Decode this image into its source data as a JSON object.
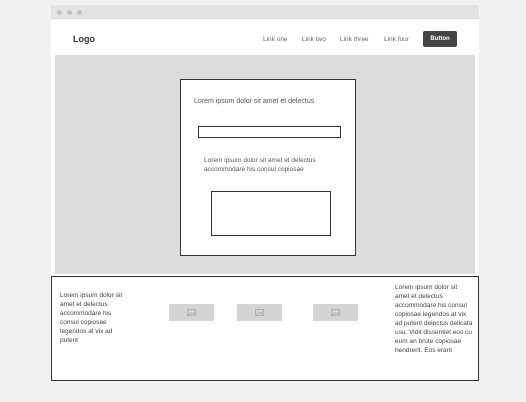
{
  "navbar": {
    "logo": "Logo",
    "links": [
      "Link one",
      "Link two",
      "Link three",
      "Link four"
    ],
    "button_label": "Button"
  },
  "hero": {
    "card": {
      "heading": "Lorem ipsum dolor sit amet et delectus",
      "input_value": "",
      "body": "Lorem ipsum dolor sit amet et delectus accommodare his consul copiosae"
    }
  },
  "footer": {
    "left_text": "Lorem ipsum dolor sit amet et delectus accommodare his consul copiosae legendos at vix ad putent",
    "right_text": "Lorem ipsum dolor sit amet et delectus accommodare his consul copiosae legendos at vix ad putent delectus delicata usu. Vidit dissentiet eos cu eum an brute copiosae hendrerit. Eos erant",
    "thumbnails": [
      "image-icon",
      "image-icon",
      "image-icon"
    ]
  },
  "colors": {
    "hero_background": "#dcdcdc",
    "button_background": "#444444",
    "thumbnail_background": "#d4d4d4"
  }
}
